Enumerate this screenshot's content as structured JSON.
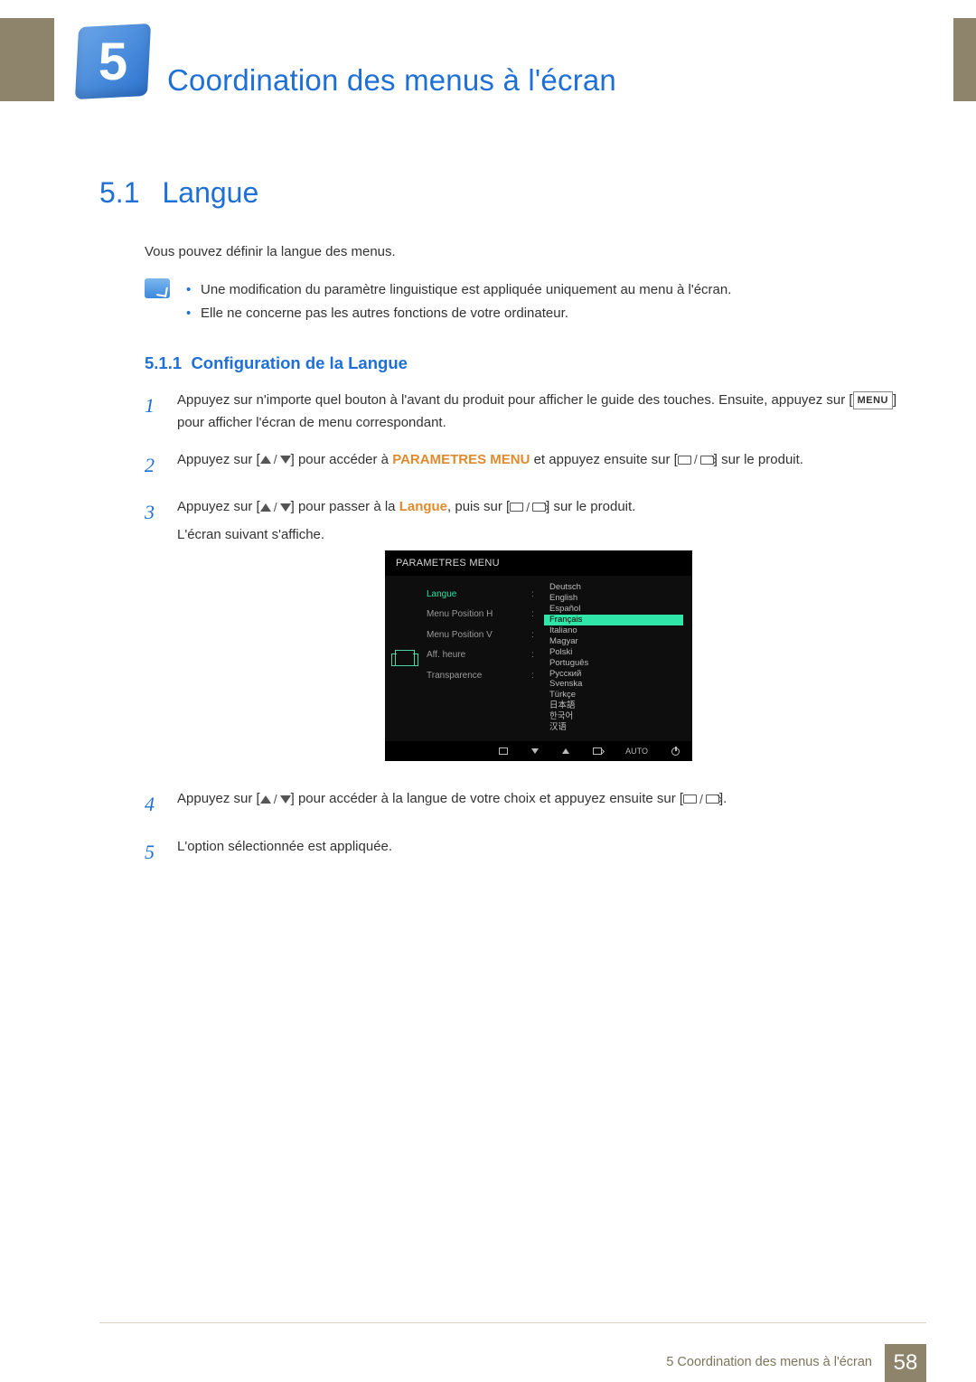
{
  "chapter": {
    "number": "5",
    "title": "Coordination des menus à l'écran"
  },
  "section": {
    "number": "5.1",
    "title": "Langue"
  },
  "intro": "Vous pouvez définir la langue des menus.",
  "notes": [
    "Une modification du paramètre linguistique est appliquée uniquement au menu à l'écran.",
    "Elle ne concerne pas les autres fonctions de votre ordinateur."
  ],
  "subsection": {
    "number": "5.1.1",
    "title": "Configuration de la Langue"
  },
  "steps": {
    "s1": {
      "a": "Appuyez sur n'importe quel bouton à l'avant du produit pour afficher le guide des touches. Ensuite, appuyez sur [",
      "menu": "MENU",
      "b": "] pour afficher l'écran de menu correspondant."
    },
    "s2": {
      "a": "Appuyez sur [",
      "b": "] pour accéder à ",
      "kw": "PARAMETRES MENU",
      "c": " et appuyez ensuite sur [",
      "d": "] sur le produit."
    },
    "s3": {
      "a": "Appuyez sur [",
      "b": "] pour passer à la ",
      "kw": "Langue",
      "c": ", puis sur [",
      "d": "] sur le produit.",
      "e": "L'écran suivant s'affiche."
    },
    "s4": {
      "a": "Appuyez sur [",
      "b": "] pour accéder à la langue de votre choix et appuyez ensuite sur [",
      "c": "]."
    },
    "s5": "L'option sélectionnée est appliquée."
  },
  "osd": {
    "title": "PARAMETRES MENU",
    "left": [
      "Langue",
      "Menu Position H",
      "Menu Position V",
      "Aff. heure",
      "Transparence"
    ],
    "right": [
      "Deutsch",
      "English",
      "Español",
      "Français",
      "Italiano",
      "Magyar",
      "Polski",
      "Português",
      "Русский",
      "Svenska",
      "Türkçe",
      "日本語",
      "한국어",
      "汉语"
    ],
    "selected_index": 3,
    "auto": "AUTO"
  },
  "footer": {
    "text": "5 Coordination des menus à l'écran",
    "page": "58"
  }
}
